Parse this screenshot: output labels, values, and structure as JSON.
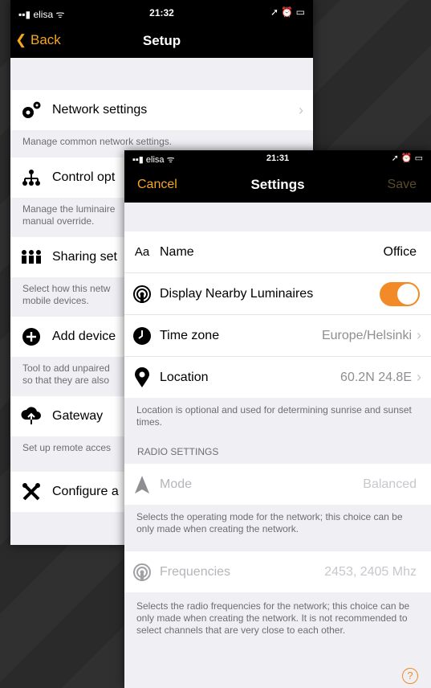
{
  "setup_screen": {
    "status": {
      "carrier": "elisa",
      "time": "21:32"
    },
    "nav": {
      "back_label": "Back",
      "title": "Setup"
    },
    "items": [
      {
        "label": "Network settings",
        "desc": "Manage common network settings."
      },
      {
        "label": "Control opt",
        "desc": "Manage the luminaire\nmanual override."
      },
      {
        "label": "Sharing set",
        "desc": "Select how this netw\nmobile devices."
      },
      {
        "label": "Add device",
        "desc": "Tool to add unpaired\nso that they are also"
      },
      {
        "label": "Gateway",
        "desc": "Set up remote acces"
      },
      {
        "label": "Configure a"
      }
    ]
  },
  "settings_screen": {
    "status": {
      "carrier": "elisa",
      "time": "21:31"
    },
    "nav": {
      "cancel_label": "Cancel",
      "title": "Settings",
      "save_label": "Save"
    },
    "name_row": {
      "icon_text": "Aa",
      "label": "Name",
      "value": "Office"
    },
    "nearby_row": {
      "label": "Display Nearby Luminaires",
      "enabled": true
    },
    "timezone_row": {
      "label": "Time zone",
      "value": "Europe/Helsinki"
    },
    "location_row": {
      "label": "Location",
      "value": "60.2N 24.8E"
    },
    "location_desc": "Location is optional and used for determining sunrise and sunset times.",
    "radio_section": "RADIO SETTINGS",
    "mode_row": {
      "label": "Mode",
      "value": "Balanced"
    },
    "mode_desc": "Selects the operating mode for the network; this choice can be only made when creating the network.",
    "freq_row": {
      "label": "Frequencies",
      "value": "2453, 2405 Mhz"
    },
    "freq_desc": "Selects the radio frequencies for the network; this choice can be only made when creating the network. It is not recommended to select channels that are very close to each other.",
    "help_label": "?"
  },
  "colors": {
    "accent": "#f28a27",
    "nav_accent": "#f5a623",
    "background": "#efeff4"
  }
}
